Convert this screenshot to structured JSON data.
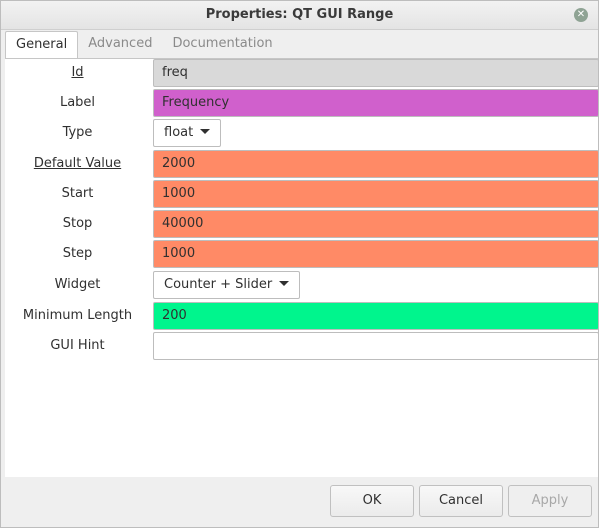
{
  "window": {
    "title": "Properties: QT GUI Range",
    "close_glyph": "✕"
  },
  "tabs": [
    {
      "label": "General",
      "active": true
    },
    {
      "label": "Advanced",
      "active": false
    },
    {
      "label": "Documentation",
      "active": false
    }
  ],
  "fields": {
    "id": {
      "label": "Id",
      "value": "freq",
      "color": "#d9d9d9"
    },
    "label": {
      "label": "Label",
      "value": "Frequency",
      "color": "#d060cc"
    },
    "type": {
      "label": "Type",
      "value": "float"
    },
    "default_value": {
      "label": "Default Value",
      "value": "2000",
      "color": "#ff8a66"
    },
    "start": {
      "label": "Start",
      "value": "1000",
      "color": "#ff8a66"
    },
    "stop": {
      "label": "Stop",
      "value": "40000",
      "color": "#ff8a66"
    },
    "step": {
      "label": "Step",
      "value": "1000",
      "color": "#ff8a66"
    },
    "widget": {
      "label": "Widget",
      "value": "Counter + Slider"
    },
    "minimum_length": {
      "label": "Minimum Length",
      "value": "200",
      "color": "#00f58d"
    },
    "gui_hint": {
      "label": "GUI Hint",
      "value": "",
      "color": "#ffffff"
    }
  },
  "buttons": {
    "ok": "OK",
    "cancel": "Cancel",
    "apply": "Apply"
  }
}
